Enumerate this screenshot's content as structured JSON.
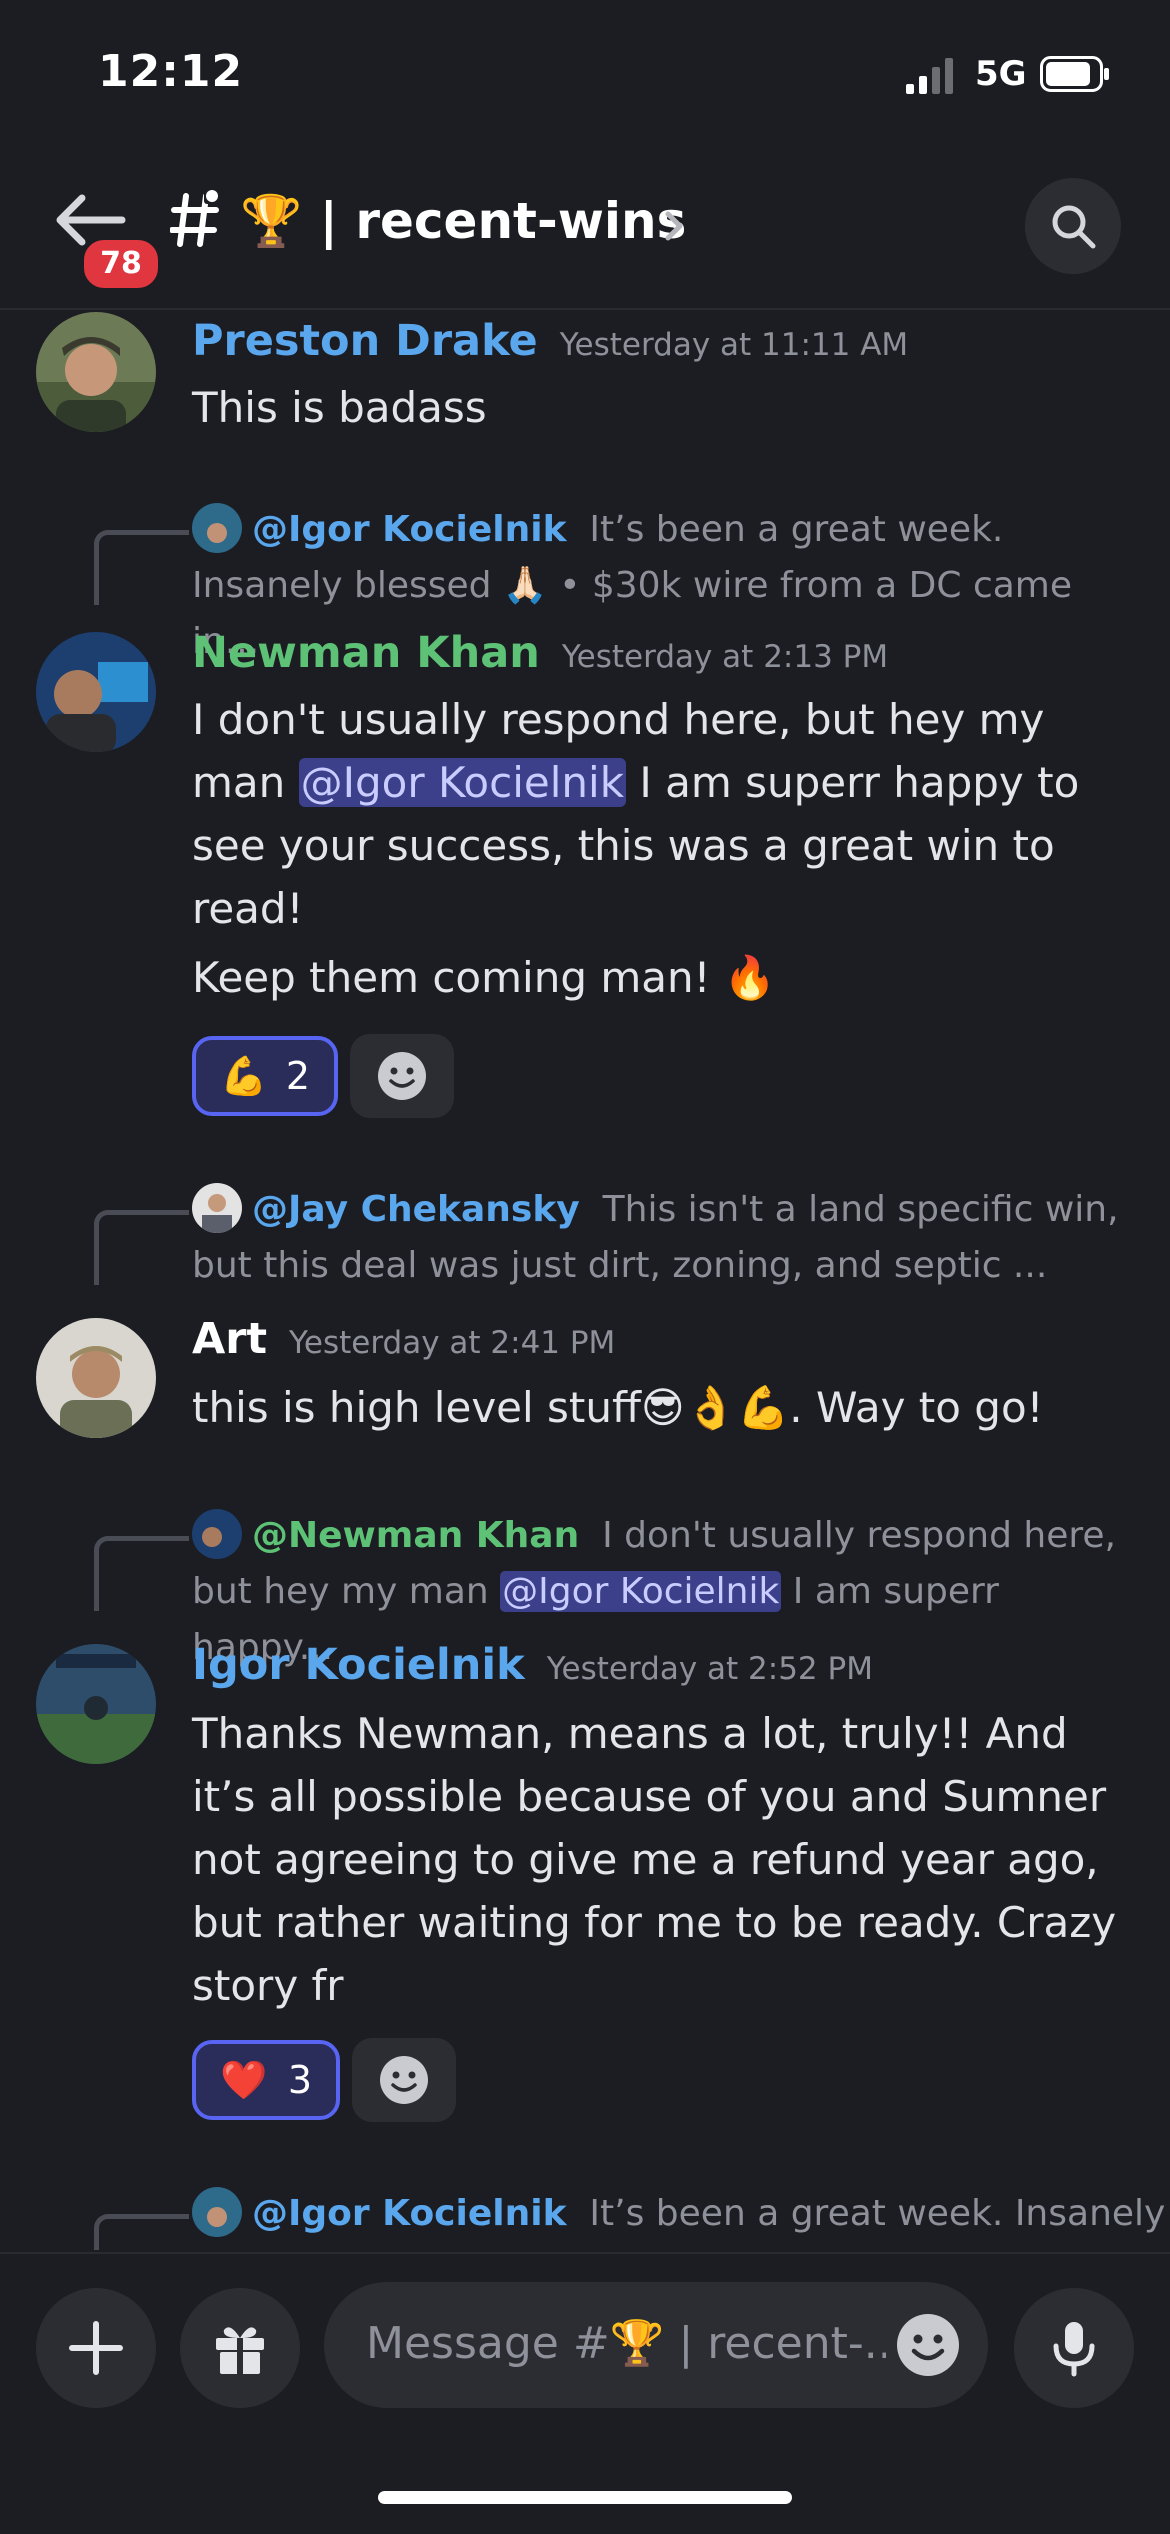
{
  "status_bar": {
    "time": "12:12",
    "network": "5G"
  },
  "header": {
    "unread_count": "78",
    "channel_name": "🏆 | recent-wins"
  },
  "messages": [
    {
      "author": "Preston Drake",
      "author_color": "#5aa7ee",
      "timestamp": "Yesterday at 11:11 AM",
      "text": "This is badass"
    },
    {
      "reply": {
        "mention": "@Igor Kocielnik",
        "preview": "It’s been a great week. Insanely blessed 🙏🏻 • $30k wire from a DC came in..."
      },
      "author": "Newman Khan",
      "author_color": "#5ec276",
      "timestamp": "Yesterday at 2:13 PM",
      "text_before": "I don't usually respond here, but hey my man ",
      "mention": "@Igor Kocielnik",
      "text_after": " I am superr happy to see your success, this was a great win to read!",
      "text_line2": "Keep them coming man! 🔥",
      "reaction": {
        "emoji": "💪",
        "count": "2"
      }
    },
    {
      "reply": {
        "mention": "@Jay Chekansky",
        "preview": "This isn't a land specific win, but this deal was just dirt, zoning, and septic ..."
      },
      "author": "Art",
      "author_color": "#ffffff",
      "timestamp": "Yesterday at 2:41 PM",
      "text": "this is high level stuff😎👌💪. Way to go!"
    },
    {
      "reply": {
        "mention": "@Newman Khan",
        "preview_before": "I don't usually respond here, but hey my man ",
        "preview_mention": "@Igor Kocielnik",
        "preview_after": " I am superr happy..."
      },
      "author": "Igor Kocielnik",
      "author_color": "#5aa7ee",
      "timestamp": "Yesterday at 2:52 PM",
      "text": "Thanks Newman, means a lot, truly!! And it’s all possible because of you and Sumner not agreeing to give me a refund year ago, but rather waiting for me to be ready. Crazy story fr",
      "reaction": {
        "emoji": "❤️",
        "count": "3"
      }
    },
    {
      "reply": {
        "mention": "@Igor Kocielnik",
        "preview": "It’s been a great week. Insanely"
      }
    }
  ],
  "composer": {
    "placeholder": "Message #🏆 | recent-.."
  },
  "colors": {
    "background": "#1c1d23",
    "accent": "#5865f2",
    "badge": "#e0363f"
  }
}
